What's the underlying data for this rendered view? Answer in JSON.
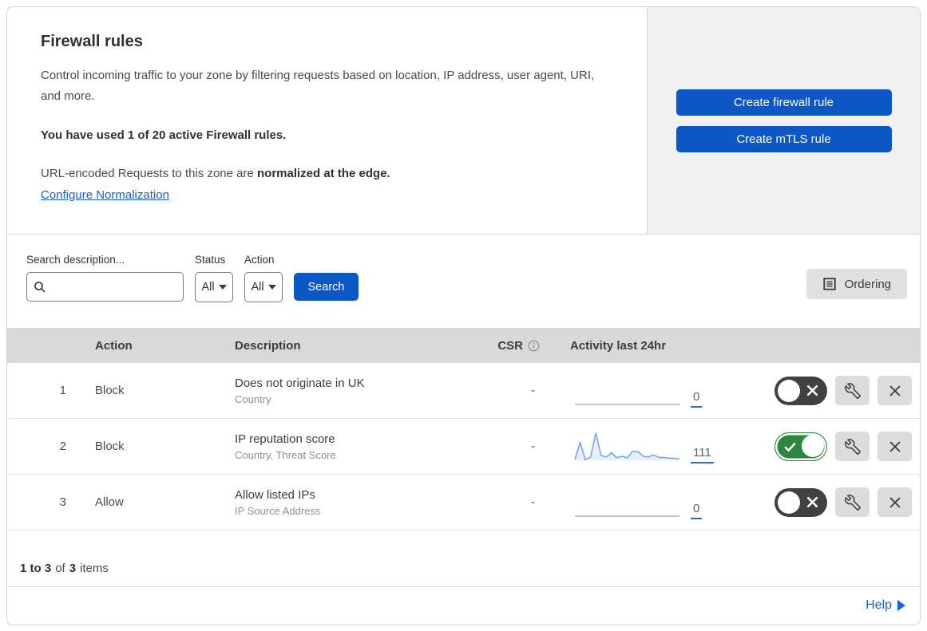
{
  "intro": {
    "title": "Firewall rules",
    "description": "Control incoming traffic to your zone by filtering requests based on location, IP address, user agent, URI, and more.",
    "usage_bold": "You have used 1 of 20 active Firewall rules.",
    "normalization_prefix": "URL-encoded Requests to this zone are ",
    "normalization_bold": "normalized at the edge.",
    "normalization_link": "Configure Normalization"
  },
  "actions_panel": {
    "create_firewall_label": "Create firewall rule",
    "create_mtls_label": "Create mTLS rule"
  },
  "filters": {
    "search_label": "Search description...",
    "status_label": "Status",
    "status_value": "All",
    "action_label": "Action",
    "action_value": "All",
    "search_button_label": "Search",
    "ordering_button_label": "Ordering"
  },
  "table": {
    "headers": {
      "action": "Action",
      "description": "Description",
      "csr": "CSR",
      "activity": "Activity last 24hr"
    },
    "rows": [
      {
        "index": "1",
        "action": "Block",
        "description": "Does not originate in UK",
        "criteria": "Country",
        "csr": "-",
        "activity_count": "0",
        "enabled": false,
        "sparkline": []
      },
      {
        "index": "2",
        "action": "Block",
        "description": "IP reputation score",
        "criteria": "Country, Threat Score",
        "csr": "-",
        "activity_count": "111",
        "enabled": true,
        "sparkline": [
          0.3,
          6.5,
          0.2,
          1.2,
          10,
          1.8,
          1.2,
          2.8,
          1.0,
          1.5,
          0.9,
          3.2,
          3.3,
          1.6,
          1.2,
          2.0,
          1.1,
          1.0,
          0.8,
          0.7,
          0.6
        ]
      },
      {
        "index": "3",
        "action": "Allow",
        "description": "Allow listed IPs",
        "criteria": "IP Source Address",
        "csr": "-",
        "activity_count": "0",
        "enabled": false,
        "sparkline": []
      }
    ]
  },
  "footer": {
    "range_bold": "1 to 3",
    "of_text": "of",
    "total_bold": "3",
    "items_text": "items",
    "help_label": "Help"
  },
  "colors": {
    "primary_blue": "#0b57c6",
    "link_blue": "#1b5fc9",
    "toggle_on_green": "#2e8540",
    "toggle_off_gray": "#414141",
    "header_gray": "#d9d9d9",
    "panel_gray": "#f1f1f1",
    "sparkline_blue": "#7aa7e8",
    "sparkline_fill": "rgba(122,167,232,0.18)",
    "flatline_gray": "#a9b4bf"
  }
}
